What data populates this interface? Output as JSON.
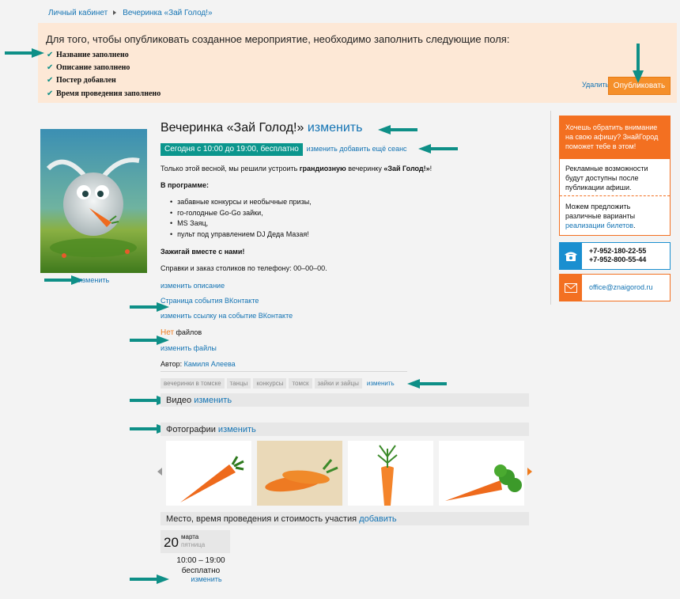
{
  "breadcrumb": {
    "item1": "Личный кабинет",
    "item2": "Вечеринка «Зай Голод!»"
  },
  "notice": {
    "title": "Для того, чтобы опубликовать созданное мероприятие, необходимо заполнить следующие поля:",
    "items": [
      "Название заполнено",
      "Описание заполнено",
      "Постер добавлен",
      "Время проведения заполнено"
    ],
    "delete_label": "Удалить",
    "publish_label": "Опубликовать"
  },
  "poster": {
    "edit_label": "изменить"
  },
  "event": {
    "title": "Вечеринка «Зай Голод!»",
    "title_edit": "изменить",
    "session_text": "Сегодня с 10:00 до 19:00, бесплатно",
    "session_edit": "изменить",
    "session_add": "добавить ещё сеанс",
    "intro_before": "Только этой весной, мы решили устроить ",
    "intro_bold": "грандиозную",
    "intro_mid": " вечеринку ",
    "intro_name": "«Зай Голод!»",
    "intro_after": "!",
    "program_title": "В программе:",
    "program": [
      "забавные конкурсы и необычные призы,",
      "го-голодные Go-Go зайки,",
      "MS Заяц,",
      "пульт под управлением DJ Деда Мазая!"
    ],
    "call": "Зажигай вместе с нами!",
    "phone_text": "Справки и заказ столиков по телефону: 00–00–00.",
    "edit_description": "изменить описание",
    "vk_page": "Страница события ВКонтакте",
    "edit_vk": "изменить ссылку на событие ВКонтакте",
    "files_none": "Нет",
    "files_label": " файлов",
    "edit_files": "изменить файлы",
    "author_label": "Автор:",
    "author_name": "Камиля Алеева"
  },
  "tags": {
    "items": [
      "вечеринки в томске",
      "танцы",
      "конкурсы",
      "томск",
      "зайки и зайцы"
    ],
    "edit_label": "изменить"
  },
  "sections": {
    "video_label": "Видео",
    "video_edit": "изменить",
    "photos_label": "Фотографии",
    "photos_edit": "изменить",
    "place_label": "Место, время проведения и стоимость участия",
    "place_add": "добавить"
  },
  "schedule": {
    "day": "20",
    "month": "марта",
    "weekday": "пятница",
    "time": "10:00 – 19:00",
    "price": "бесплатно",
    "edit_label": "изменить"
  },
  "sidebar": {
    "promo_head": "Хочешь обратить внимание на свою афишу? ЗнайГород поможет тебе в этом!",
    "promo_mid": "Рекламные возможности будут доступны после публикации афиши.",
    "promo_bot_text": "Можем предложить различные варианты ",
    "promo_bot_link": "реализации билетов",
    "promo_bot_end": ".",
    "phone1": "+7-952-180-22-55",
    "phone2": "+7-952-800-55-44",
    "email": "office@znaigorod.ru"
  },
  "colors": {
    "accent_teal": "#0b968d",
    "accent_orange": "#f37021",
    "link_blue": "#1474b4",
    "notice_bg": "#fde8d6",
    "publish_btn": "#f58f2a"
  },
  "icons": {
    "arrow": "arrow-right-icon",
    "arrow_down": "arrow-down-icon",
    "check": "check-icon",
    "phone": "phone-icon",
    "mail": "envelope-icon"
  }
}
